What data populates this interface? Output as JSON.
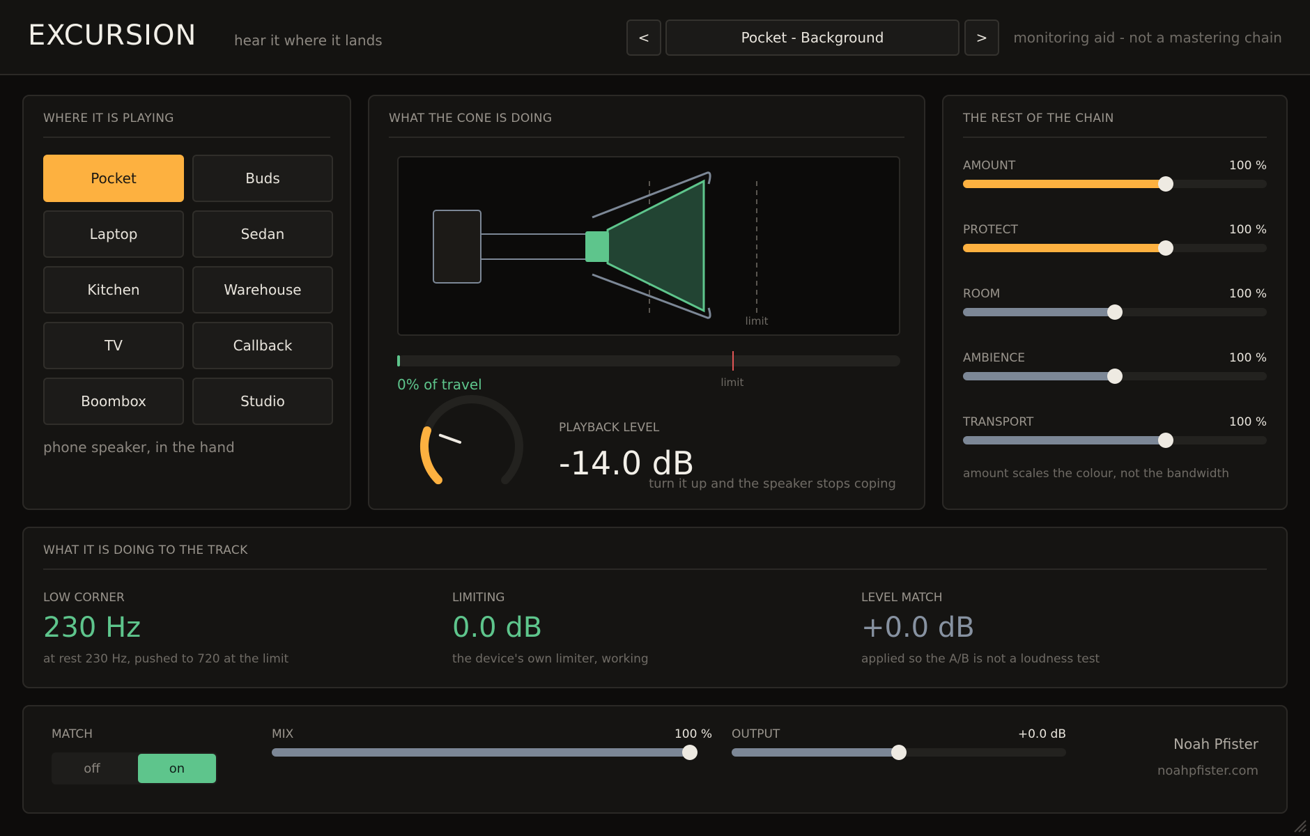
{
  "header": {
    "title": "EXCURSION",
    "tagline": "hear it where it lands",
    "prev_label": "<",
    "next_label": ">",
    "preset": "Pocket - Background",
    "note": "monitoring aid - not a mastering chain"
  },
  "devices": {
    "title": "WHERE IT IS PLAYING",
    "items": [
      "Pocket",
      "Buds",
      "Laptop",
      "Sedan",
      "Kitchen",
      "Warehouse",
      "TV",
      "Callback",
      "Boombox",
      "Studio"
    ],
    "selected": "Pocket",
    "description": "phone speaker, in the hand"
  },
  "cone": {
    "title": "WHAT THE CONE IS DOING",
    "limit_label": "limit",
    "travel_text": "0% of travel",
    "travel_fraction": 0.0,
    "limit_fraction": 0.666,
    "playback_label": "PLAYBACK LEVEL",
    "playback_value": "-14.0 dB",
    "playback_note": "turn it up and the speaker stops coping",
    "knob_fraction": 0.24
  },
  "chain": {
    "title": "THE REST OF THE CHAIN",
    "sliders": [
      {
        "label": "AMOUNT",
        "value": "100 %",
        "fraction": 0.667,
        "color": "#fdb140"
      },
      {
        "label": "PROTECT",
        "value": "100 %",
        "fraction": 0.667,
        "color": "#fdb140"
      },
      {
        "label": "ROOM",
        "value": "100 %",
        "fraction": 0.5,
        "color": "#7c8796"
      },
      {
        "label": "AMBIENCE",
        "value": "100 %",
        "fraction": 0.5,
        "color": "#7c8796"
      },
      {
        "label": "TRANSPORT",
        "value": "100 %",
        "fraction": 0.667,
        "color": "#7c8796"
      }
    ],
    "note": "amount scales the colour, not the bandwidth"
  },
  "track": {
    "title": "WHAT IT IS DOING TO THE TRACK",
    "stats": [
      {
        "label": "LOW CORNER",
        "value": "230 Hz",
        "note": "at rest 230 Hz, pushed to 720 at the limit",
        "color": "#5ec58c"
      },
      {
        "label": "LIMITING",
        "value": "0.0 dB",
        "note": "the device's own limiter, working",
        "color": "#5ec58c"
      },
      {
        "label": "LEVEL MATCH",
        "value": "+0.0 dB",
        "note": "applied so the A/B is not a loudness test",
        "color": "#8792a1"
      }
    ]
  },
  "footer": {
    "match_label": "MATCH",
    "off_label": "off",
    "on_label": "on",
    "mix_label": "MIX",
    "mix_value": "100 %",
    "mix_fraction": 1.0,
    "output_label": "OUTPUT",
    "output_value": "+0.0 dB",
    "output_fraction": 0.5,
    "author": "Noah Pfister",
    "site": "noahpfister.com"
  },
  "colors": {
    "accent": "#fdb140",
    "green": "#5ec58c",
    "slate": "#7c8796"
  }
}
